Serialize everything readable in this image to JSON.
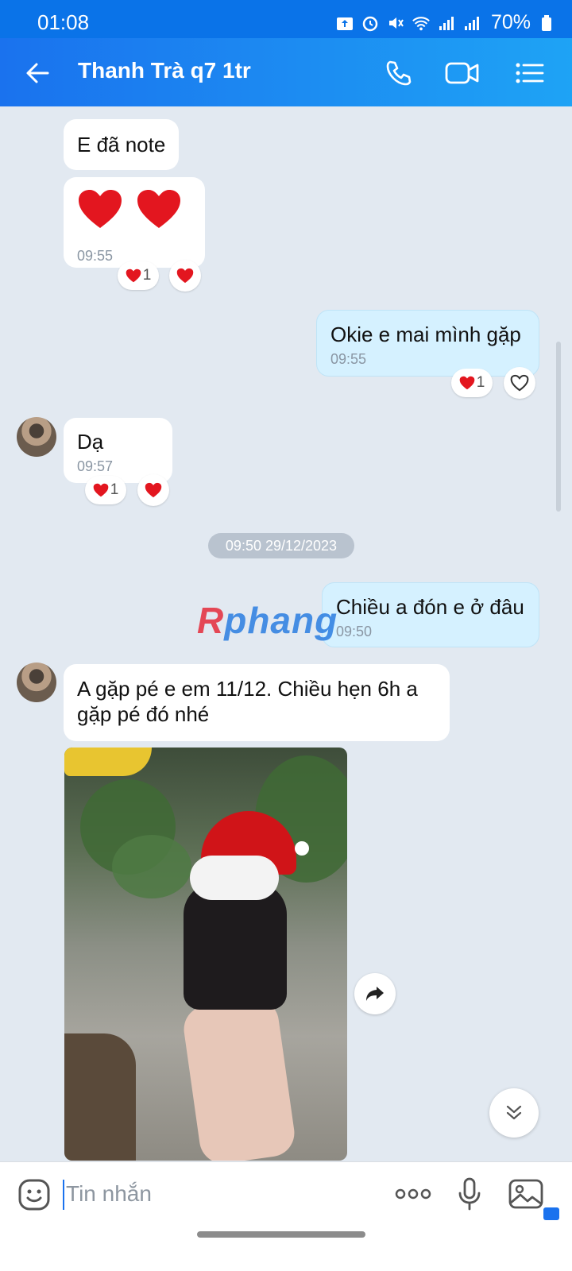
{
  "status_bar": {
    "time": "01:08",
    "battery": "70%"
  },
  "header": {
    "title": "Thanh Trà q7 1tr"
  },
  "messages": [
    {
      "text": "E đã note"
    },
    {
      "text": "❤️ ❤️",
      "time": "09:55",
      "reaction_count": "1"
    },
    {
      "text": "Okie e mai mình gặp",
      "time": "09:55",
      "reaction_count": "1"
    },
    {
      "text": "Dạ",
      "time": "09:57",
      "reaction_count": "1"
    },
    {
      "text": "Chiều a đón e ở đâu",
      "time": "09:50"
    },
    {
      "text": "A gặp pé e em 11/12. Chiều hẹn 6h a gặp pé đó nhé"
    }
  ],
  "date_separator": "09:50 29/12/2023",
  "watermark": {
    "r": "R",
    "rest": "phang"
  },
  "input": {
    "placeholder": "Tin nhắn"
  },
  "colors": {
    "header_start": "#1a72ee",
    "header_end": "#1ea3f5",
    "outgoing_bubble": "#d5f1ff",
    "background": "#e2e9f1"
  }
}
